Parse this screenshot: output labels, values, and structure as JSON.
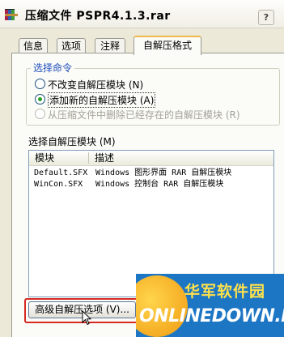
{
  "window": {
    "title": "压缩文件 PSPR4.1.3.rar",
    "help": "?"
  },
  "tabs": [
    {
      "label": "信息"
    },
    {
      "label": "选项"
    },
    {
      "label": "注释"
    },
    {
      "label": "自解压格式",
      "active": true
    }
  ],
  "command_group": {
    "title": "选择命令",
    "options": [
      {
        "label": "不改变自解压模块 (N)",
        "checked": false,
        "disabled": false
      },
      {
        "label": "添加新的自解压模块 (A)",
        "checked": true,
        "disabled": false
      },
      {
        "label": "从压缩文件中删除已经存在的自解压模块 (R)",
        "checked": false,
        "disabled": true
      }
    ]
  },
  "module_list": {
    "label": "选择自解压模块 (M)",
    "columns": [
      "模块",
      "描述"
    ],
    "rows": [
      {
        "module": "Default.SFX",
        "description": "Windows 图形界面 RAR 自解压模块"
      },
      {
        "module": "WinCon.SFX",
        "description": "Windows 控制台 RAR 自解压模块"
      }
    ]
  },
  "advanced_button": {
    "label": "高级自解压选项 (V)..."
  },
  "watermark": {
    "cn": "华军软件园",
    "en": "ONLINEDOWN.NET",
    "suffix": ".NET"
  },
  "colors": {
    "group_title": "#1d4dbb",
    "tab_accent": "#f0b74a",
    "highlight": "#d42a22",
    "watermark_bg": "#1d76c4"
  }
}
